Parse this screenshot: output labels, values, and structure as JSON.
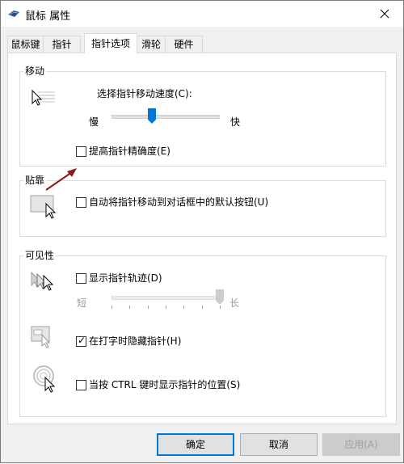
{
  "window": {
    "title": "鼠标 属性"
  },
  "tabs": [
    {
      "label": "鼠标键"
    },
    {
      "label": "指针"
    },
    {
      "label": "指针选项"
    },
    {
      "label": "滑轮"
    },
    {
      "label": "硬件"
    }
  ],
  "motion": {
    "group_title": "移动",
    "speed_label": "选择指针移动速度(C):",
    "slow_label": "慢",
    "fast_label": "快",
    "speed_value": 0.38,
    "precision_label": "提高指针精确度(E)",
    "precision_checked": false
  },
  "snap": {
    "group_title": "贴靠",
    "snap_label": "自动将指针移动到对话框中的默认按钮(U)",
    "snap_checked": false
  },
  "visibility": {
    "group_title": "可见性",
    "trails_label": "显示指针轨迹(D)",
    "trails_checked": false,
    "short_label": "短",
    "long_label": "长",
    "trails_value": 1.0,
    "hide_label": "在打字时隐藏指针(H)",
    "hide_checked": true,
    "ctrl_label": "当按 CTRL 键时显示指针的位置(S)",
    "ctrl_checked": false
  },
  "buttons": {
    "ok": "确定",
    "cancel": "取消",
    "apply": "应用(A)"
  },
  "colors": {
    "accent": "#0078d7",
    "annotation_arrow": "#8b1a1a"
  }
}
